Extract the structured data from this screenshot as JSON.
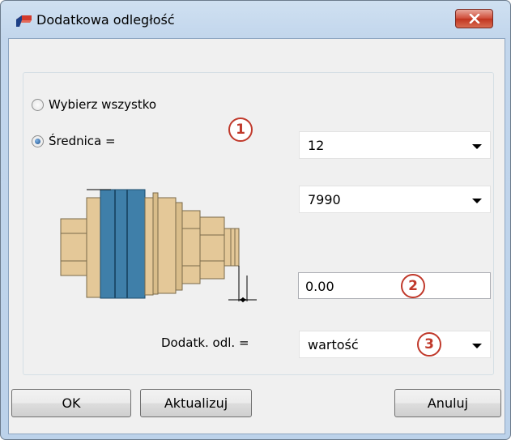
{
  "window": {
    "title": "Dodatkowa odległość",
    "close_label": "Close"
  },
  "options": {
    "select_all_label": "Wybierz wszystko",
    "diameter_label": "Średnica ="
  },
  "diameter_dropdown": {
    "value": "12"
  },
  "material_dropdown": {
    "value": "7990"
  },
  "extra_distance_field": {
    "value": "0.00"
  },
  "extra_distance_row": {
    "label": "Dodatk. odl. =",
    "dropdown_value": "wartość"
  },
  "callouts": {
    "one": "1",
    "two": "2",
    "three": "3"
  },
  "buttons": {
    "ok": "OK",
    "update": "Aktualizuj",
    "cancel": "Anuluj"
  },
  "colors": {
    "callout": "#c0392b",
    "title_gradient": "#c2d6ec",
    "close_button": "#c0341f"
  }
}
